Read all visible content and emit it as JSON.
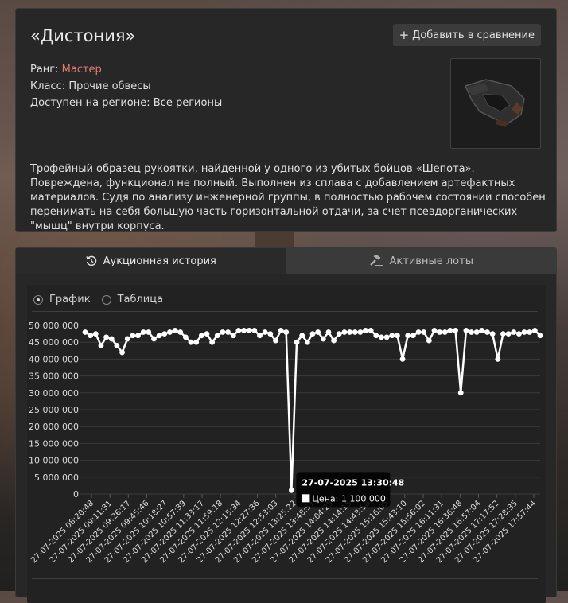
{
  "item": {
    "title": "«Дистония»",
    "compare_label": "Добавить в сравнение",
    "rank_label": "Ранг:",
    "rank_value": "Мастер",
    "class_label": "Класс:",
    "class_value": "Прочие обвесы",
    "region_label": "Доступен на регионе:",
    "region_value": "Все регионы",
    "description": "Трофейный образец рукоятки, найденной у одного из убитых бойцов «Шепота». Повреждена, функционал не полный. Выполнен из сплава с добавлением артефактных материалов. Судя по анализу инженерной группы, в полностью рабочем состоянии способен перенимать на себя большую часть горизонтальной отдачи, за счет псевдорганических \"мышц\" внутри корпуса."
  },
  "tabs": [
    {
      "label": "Аукционная история",
      "icon": "history-icon",
      "active": true
    },
    {
      "label": "Активные лоты",
      "icon": "gavel-icon",
      "active": false
    }
  ],
  "view_toggle": {
    "chart_label": "График",
    "table_label": "Таблица",
    "selected": "chart"
  },
  "tooltip": {
    "title": "27-07-2025 13:30:48",
    "price_label": "Цена:",
    "price_value": "1 100 000"
  },
  "colors": {
    "accent_rank": "#e27a75",
    "line": "#ffffff"
  },
  "chart_data": {
    "type": "line",
    "y_ticks": [
      "50 000 000",
      "45 000 000",
      "40 000 000",
      "35 000 000",
      "30 000 000",
      "25 000 000",
      "20 000 000",
      "15 000 000",
      "10 000 000",
      "5 000 000",
      "0"
    ],
    "ylim": [
      0,
      50000000
    ],
    "x_tick_labels": [
      "27-07-2025 08:20:48",
      "27-07-2025 09:11:31",
      "27-07-2025 09:26:17",
      "27-07-2025 09:45:46",
      "27-07-2025 10:18:27",
      "27-07-2025 10:57:39",
      "27-07-2025 11:33:17",
      "27-07-2025 11:59:18",
      "27-07-2025 12:15:34",
      "27-07-2025 12:27:36",
      "27-07-2025 12:53:03",
      "27-07-2025 13:25:22",
      "27-07-2025 13:48:51",
      "27-07-2025 14:04:25",
      "27-07-2025 14:14:15",
      "27-07-2025 14:43:58",
      "27-07-2025 15:16:05",
      "27-07-2025 15:43:10",
      "27-07-2025 15:56:02",
      "27-07-2025 16:11:31",
      "27-07-2025 16:36:48",
      "27-07-2025 16:57:04",
      "27-07-2025 17:17:52",
      "27-07-2025 17:28:35",
      "27-07-2025 17:57:44"
    ],
    "series": [
      {
        "values": [
          48000000,
          47000000,
          47500000,
          44000000,
          46500000,
          46000000,
          44000000,
          42000000,
          46000000,
          47000000,
          47000000,
          48000000,
          48000000,
          46000000,
          47000000,
          47500000,
          48000000,
          48500000,
          48000000,
          46500000,
          45000000,
          45000000,
          47000000,
          47500000,
          45000000,
          47000000,
          48000000,
          48000000,
          47000000,
          48500000,
          48500000,
          48500000,
          48500000,
          47000000,
          48000000,
          47500000,
          45500000,
          48500000,
          48000000,
          1100000,
          45000000,
          47000000,
          45000000,
          47500000,
          48000000,
          46000000,
          48000000,
          45500000,
          47500000,
          48000000,
          48000000,
          48000000,
          48000000,
          48500000,
          48500000,
          47000000,
          46500000,
          46500000,
          47000000,
          47000000,
          40000000,
          47000000,
          47000000,
          48000000,
          48000000,
          45500000,
          48500000,
          48000000,
          48000000,
          48500000,
          48500000,
          30000000,
          48500000,
          48000000,
          48000000,
          48500000,
          48000000,
          47500000,
          40000000,
          47500000,
          47500000,
          48000000,
          47500000,
          48000000,
          48000000,
          48500000,
          47000000
        ]
      }
    ]
  }
}
